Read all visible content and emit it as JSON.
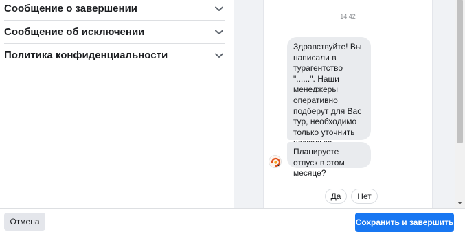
{
  "sections": [
    {
      "label": "Сообщение о завершении",
      "icon": "chevron-down-icon"
    },
    {
      "label": "Сообщение об исключении",
      "icon": "chevron-down-icon"
    },
    {
      "label": "Политика конфиденциальности",
      "icon": "chevron-down-icon"
    }
  ],
  "preview": {
    "time": "14:42",
    "messages": [
      {
        "text": "Здравствуйте! Вы написали в турагентство \"......\". Наши менеджеры оперативно подберут для Вас тур, необходимо только уточнить несколько деталей",
        "emoji": "👇"
      },
      {
        "text": "Планируете отпуск в этом месяце?"
      }
    ],
    "quick_replies": [
      "Да",
      "Нет"
    ],
    "avatar_icon": "bot-avatar-icon"
  },
  "footer": {
    "cancel_label": "Отмена",
    "save_label": "Сохранить и завершить"
  },
  "colors": {
    "primary": "#1877f2",
    "bubble": "#e9ebee",
    "preview_bg": "#f0f2f5"
  }
}
